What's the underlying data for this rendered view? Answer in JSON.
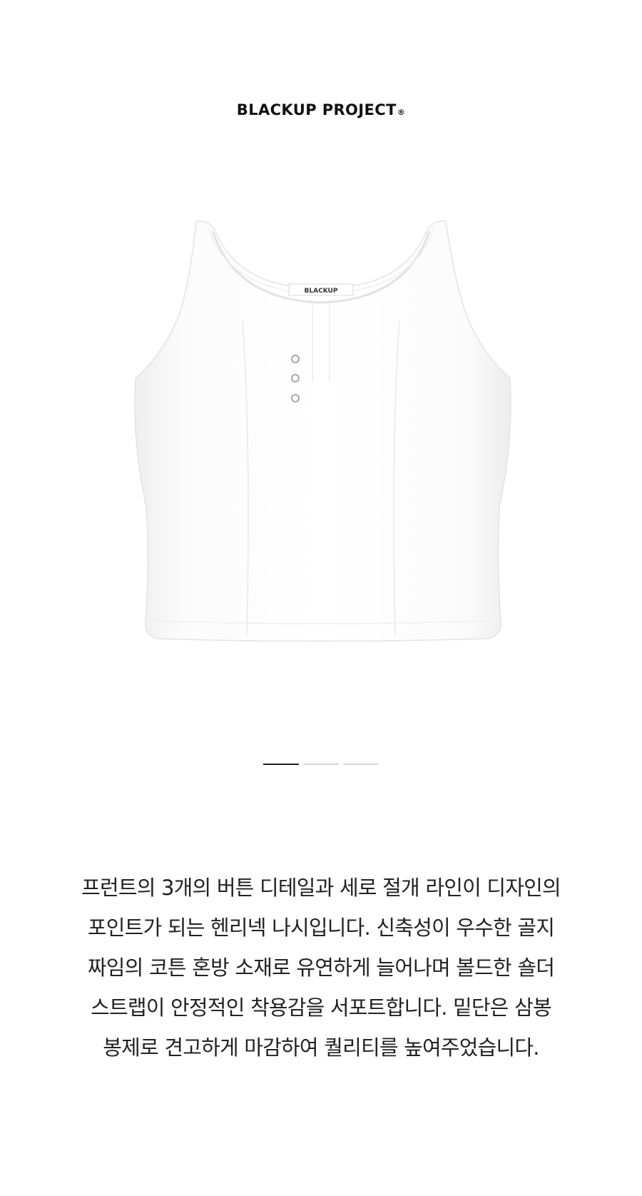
{
  "brand": {
    "name": "BLACKUP PROJECT",
    "registered_mark": "®"
  },
  "product": {
    "image_alt": "white ribbed henley sleeveless tank top",
    "neck_label": "BLACKUP",
    "garment_color": "#ffffff"
  },
  "carousel": {
    "total_slides": 3,
    "active_index": 0
  },
  "description": {
    "lines": [
      "프런트의 3개의 버튼 디테일과 세로 절개 라인이 디자인의",
      "포인트가 되는 헨리넥 나시입니다. 신축성이 우수한 골지",
      "짜임의 코튼 혼방 소재로 유연하게 늘어나며 볼드한 숄더",
      "스트랩이 안정적인 착용감을 서포트합니다. 밑단은 삼봉",
      "봉제로 견고하게 마감하여 퀄리티를 높여주었습니다."
    ]
  },
  "colors": {
    "text": "#222222",
    "pager_active": "#222222",
    "pager_inactive": "#d8d8d8",
    "background": "#ffffff"
  }
}
